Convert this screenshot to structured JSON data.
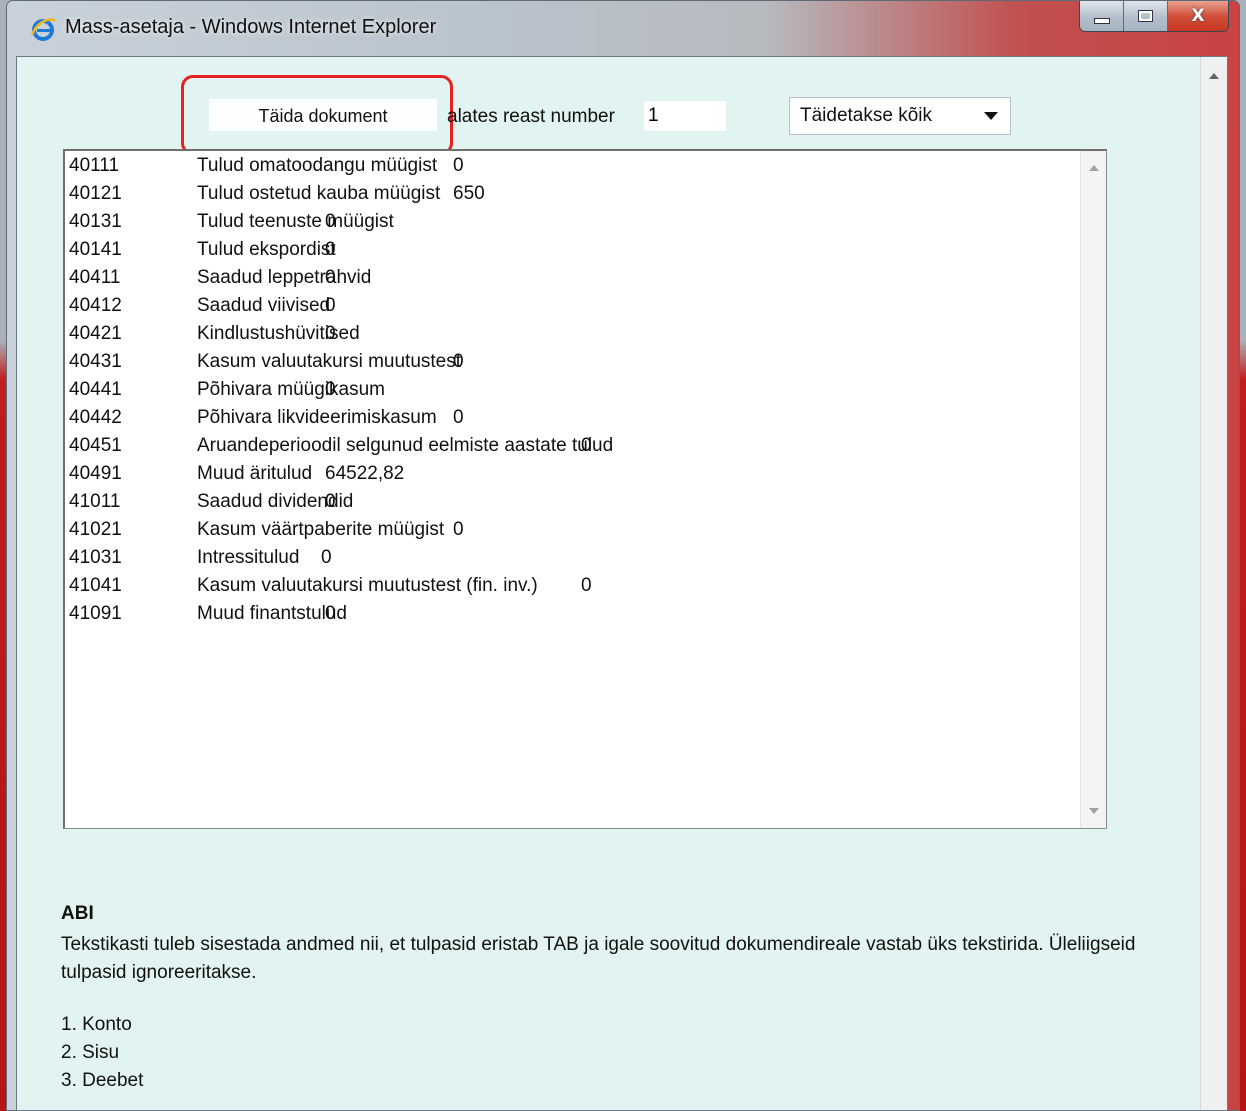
{
  "window": {
    "title": "Mass-asetaja - Windows Internet Explorer",
    "close_symbol": "X"
  },
  "toolbar": {
    "fill_button_label": "Täida dokument",
    "start_row_label": "alates reast number",
    "start_row_value": "1",
    "fill_mode_selected": "Täidetakse kõik"
  },
  "textarea_rows": [
    {
      "account": "40111",
      "name": "Tulud omatoodangu müügist",
      "value": "0",
      "col": 3
    },
    {
      "account": "40121",
      "name": "Tulud ostetud kauba müügist",
      "value": "650",
      "col": 3
    },
    {
      "account": "40131",
      "name": "Tulud teenuste müügist",
      "value": "0",
      "col": 2
    },
    {
      "account": "40141",
      "name": "Tulud ekspordist",
      "value": "0",
      "col": 2
    },
    {
      "account": "40411",
      "name": "Saadud leppetrahvid",
      "value": "0",
      "col": 2
    },
    {
      "account": "40412",
      "name": "Saadud viivised",
      "value": "0",
      "col": 2
    },
    {
      "account": "40421",
      "name": "Kindlustushüvitised",
      "value": "0",
      "col": 2
    },
    {
      "account": "40431",
      "name": "Kasum valuutakursi muutustest",
      "value": "0",
      "col": 3
    },
    {
      "account": "40441",
      "name": "Põhivara müügikasum",
      "value": "0",
      "col": 2
    },
    {
      "account": "40442",
      "name": "Põhivara likvideerimiskasum",
      "value": "0",
      "col": 3
    },
    {
      "account": "40451",
      "name": "Aruandeperioodil selgunud eelmiste aastate tulud",
      "value": "0",
      "col": 4
    },
    {
      "account": "40491",
      "name": "Muud äritulud",
      "value": "64522,82",
      "col": 2
    },
    {
      "account": "41011",
      "name": "Saadud dividendid",
      "value": "0",
      "col": 2
    },
    {
      "account": "41021",
      "name": "Kasum väärtpaberite müügist",
      "value": "0",
      "col": 3
    },
    {
      "account": "41031",
      "name": "Intressitulud",
      "value": "0",
      "col": 1
    },
    {
      "account": "41041",
      "name": "Kasum valuutakursi muutustest (fin. inv.)",
      "value": "0",
      "col": 4
    },
    {
      "account": "41091",
      "name": "Muud finantstulud",
      "value": "0",
      "col": 2
    }
  ],
  "help": {
    "title": "ABI",
    "text": "Tekstikasti tuleb sisestada andmed nii, et tulpasid eristab TAB ja igale soovitud dokumendireale vastab üks tekstirida. Üleliigseid tulpasid ignoreeritakse.",
    "items": [
      "1. Konto",
      "2. Sisu",
      "3. Deebet"
    ]
  },
  "colors": {
    "content_bg": "#e2f4f1",
    "highlight": "#e52020"
  },
  "icons": [
    "ie-logo-icon",
    "minimize-icon",
    "maximize-icon",
    "close-icon",
    "scroll-up-icon",
    "scroll-down-icon",
    "dropdown-arrow-icon"
  ]
}
